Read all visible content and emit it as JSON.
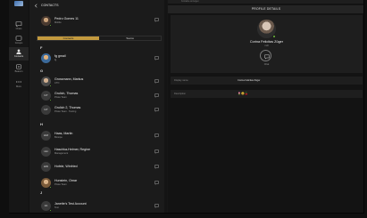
{
  "rail": {
    "items": [
      {
        "label": "Chats",
        "icon": "chat-bubble-icon"
      },
      {
        "label": "Groups",
        "icon": "groups-icon"
      },
      {
        "label": "Contacts",
        "icon": "contact-person-icon",
        "active": true
      },
      {
        "label": "Beacon",
        "icon": "beacon-icon"
      },
      {
        "label": "More",
        "icon": "more-icon"
      }
    ]
  },
  "contacts": {
    "header": "CONTACTS",
    "me": {
      "name": "Pedro Gomes 11",
      "sub": "Mobile",
      "initials": ""
    },
    "tabs": [
      "Contacts",
      "Teams"
    ],
    "sections": [
      {
        "letter": "F",
        "rows": [
          {
            "name": "fg gmail",
            "sub": "fg",
            "initials": "",
            "photo": true,
            "online": false
          }
        ]
      },
      {
        "letter": "G",
        "rows": [
          {
            "name": "Grossmann, Markus",
            "sub": "CTO",
            "initials": "",
            "photo": true,
            "online": true
          },
          {
            "name": "Grulich, Thomas",
            "sub": "Pirate Team",
            "initials": "GT",
            "photo": false,
            "online": true
          },
          {
            "name": "Grulich 2, Thomas",
            "sub": "Pirate Team · Testing",
            "initials": "GT",
            "photo": false,
            "online": false
          }
        ]
      },
      {
        "letter": "H",
        "rows": [
          {
            "name": "Haas, Martin",
            "sub": "Biotope",
            "initials": "HM",
            "photo": false,
            "online": false
          },
          {
            "name": "Haschka-Helmer, Regine",
            "sub": "Management",
            "initials": "HH",
            "photo": false,
            "online": false
          },
          {
            "name": "Hofele, Winfried",
            "sub": "",
            "initials": "HW",
            "photo": false,
            "online": false
          },
          {
            "name": "Hunstein, Omar",
            "sub": "Pirate Team",
            "initials": "",
            "photo": true,
            "online": true
          }
        ]
      },
      {
        "letter": "J",
        "rows": [
          {
            "name": "Janette's Test Account",
            "sub": "Test",
            "initials": "JA",
            "photo": false,
            "online": true
          }
        ]
      }
    ]
  },
  "detail": {
    "top_strip": "Kontakte anzeigen",
    "title": "PROFILE DETAILS",
    "profile_name": "Corina Felicitas Züger",
    "profile_sub": "null",
    "chat_label": "Chat",
    "fields": [
      {
        "key": "Display name",
        "value": "Corina Felicitas Züger"
      },
      {
        "key": "Description",
        "value": "🌷😀🍒"
      }
    ]
  },
  "colors": {
    "accent": "#c39a3e",
    "online": "#6fbf3a",
    "background": "#161616"
  }
}
